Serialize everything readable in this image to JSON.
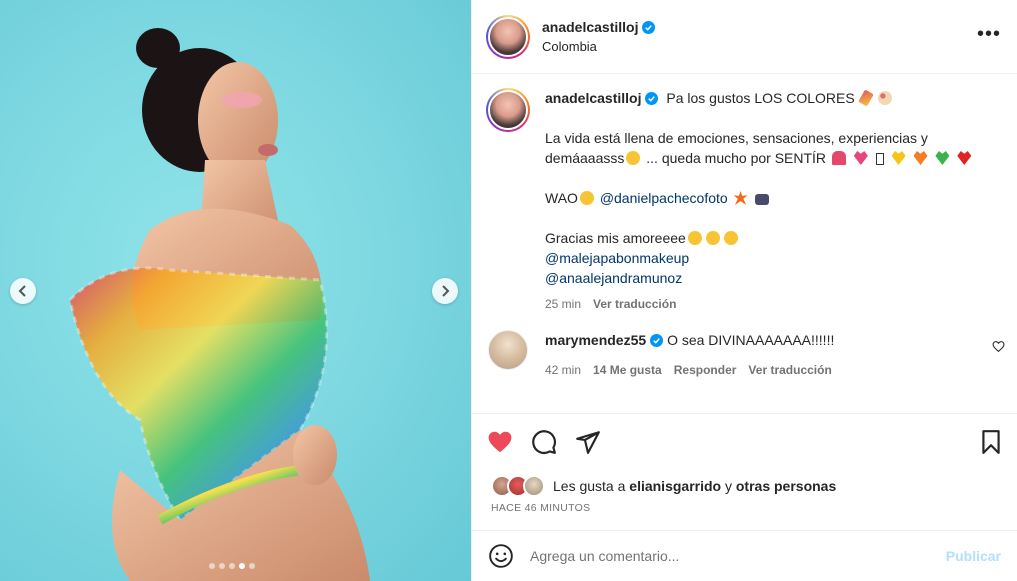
{
  "post": {
    "username": "anadelcastilloj",
    "location": "Colombia",
    "photo_count": 5,
    "photo_active_index": 3
  },
  "caption": {
    "username": "anadelcastilloj",
    "line1": "Pa los gustos LOS COLORES",
    "para2_a": "La vida está llena de emociones, sensaciones, experiencias y demáaaasss",
    "para2_b": "... queda mucho por SENTÍR",
    "para3_text": "WAO",
    "para3_mention": "@danielpachecofoto",
    "para4_text": "Gracias mis amoreeee",
    "para4_mention1": "@malejapabonmakeup",
    "para4_mention2": "@anaalejandramunoz",
    "time": "25 min",
    "translate": "Ver traducción"
  },
  "comment": {
    "username": "marymendez55",
    "text": "O sea DIVINAAAAAAA!!!!!!",
    "time": "42 min",
    "likes": "14 Me gusta",
    "reply": "Responder",
    "translate": "Ver traducción"
  },
  "likes_line": {
    "prefix": "Les gusta a",
    "user": "elianisgarrido",
    "connector": "y",
    "others": "otras personas"
  },
  "time_ago": "HACE 46 MINUTOS",
  "add_comment": {
    "placeholder": "Agrega un comentario...",
    "publish": "Publicar"
  },
  "colors": {
    "like_red": "#ed4956",
    "verified_blue": "#0095f6",
    "link_blue": "#00376b",
    "publish_disabled": "#b2dffc"
  }
}
